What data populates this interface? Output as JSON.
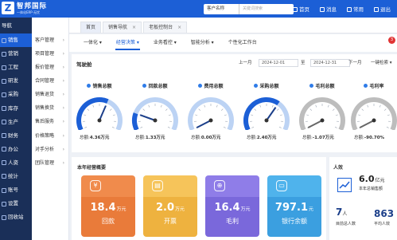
{
  "brand": {
    "logo_letter": "Z",
    "name": "智邦国际",
    "slogan": "一体化ERP·无忧"
  },
  "search": {
    "scope": "客户名称",
    "placeholder": "关键词搜索"
  },
  "top_links": [
    "首页",
    "消息",
    "常用",
    "退出"
  ],
  "nav_head": "导航",
  "modules": [
    "销售",
    "营销",
    "工程",
    "研发",
    "采购",
    "库存",
    "生产",
    "财务",
    "办公",
    "人资",
    "统计",
    "账号",
    "设置",
    "回收站"
  ],
  "sub_head": "客户管理",
  "submenu": [
    "项目管理",
    "报价管理",
    "合同管理",
    "销售退货",
    "销售换货",
    "售后服务",
    "价格策略",
    "对手分析",
    "团队管理"
  ],
  "tabs": [
    {
      "label": "首页",
      "active": true
    },
    {
      "label": "销售导航",
      "active": false
    },
    {
      "label": "老板控制台",
      "active": false
    }
  ],
  "nav_items": [
    {
      "label": "一体化 ▾",
      "active": false
    },
    {
      "label": "经营决策 ▾",
      "active": true
    },
    {
      "label": "业务看控 ▾",
      "active": false
    },
    {
      "label": "智能分析 ▾",
      "active": false
    },
    {
      "label": "个性化工作台",
      "active": false
    }
  ],
  "notify_badge": "3",
  "overview": {
    "title": "驾驶舱",
    "prev": "上一月",
    "next": "下一月",
    "start_date": "2024-12-01",
    "to": "至",
    "end_date": "2024-12-31",
    "oneclick": "一键检索 ▾"
  },
  "gauges": [
    {
      "label": "销售总额",
      "total_prefix": "总额:",
      "total": "4.36万元",
      "fraction": 0.6,
      "color": "#1c5fd6"
    },
    {
      "label": "回款总额",
      "total_prefix": "总额:",
      "total": "1.33万元",
      "fraction": 0.2,
      "color": "#1c5fd6"
    },
    {
      "label": "费用总额",
      "total_prefix": "总额:",
      "total": "0.00万元",
      "fraction": 0.0,
      "color": "#1c5fd6"
    },
    {
      "label": "采购总额",
      "total_prefix": "总额:",
      "total": "2.40万元",
      "fraction": 0.65,
      "color": "#1c5fd6"
    },
    {
      "label": "毛利总额",
      "total_prefix": "总额:",
      "total": "-1.07万元",
      "fraction": 0.0,
      "color": "#8c8c8c"
    },
    {
      "label": "毛利率",
      "total_prefix": "总额:",
      "total": "-90.70%",
      "fraction": 0.0,
      "color": "#8c8c8c"
    }
  ],
  "kpi_section": {
    "title": "本年经营概要",
    "cards": [
      {
        "value": "18.4",
        "unit": "万元",
        "label": "回款",
        "top_color": "#f08b4c",
        "bottom_color": "#e97b3a"
      },
      {
        "value": "2.0",
        "unit": "万元",
        "label": "开票",
        "top_color": "#f6c45a",
        "bottom_color": "#eeb23f"
      },
      {
        "value": "16.4",
        "unit": "万元",
        "label": "毛利",
        "top_color": "#8f7de8",
        "bottom_color": "#7a68db"
      },
      {
        "value": "797.1",
        "unit": "元",
        "label": "银行余额",
        "top_color": "#4fb3ec",
        "bottom_color": "#3b9fe0"
      }
    ]
  },
  "people": {
    "title": "人效",
    "big": "6.0",
    "big_unit": "亿元",
    "big_label": "本年总销售额",
    "n1": "7",
    "n1_unit": "人",
    "n1_label": "目前总人数",
    "n2": "863",
    "n2_label": "平均人效"
  }
}
